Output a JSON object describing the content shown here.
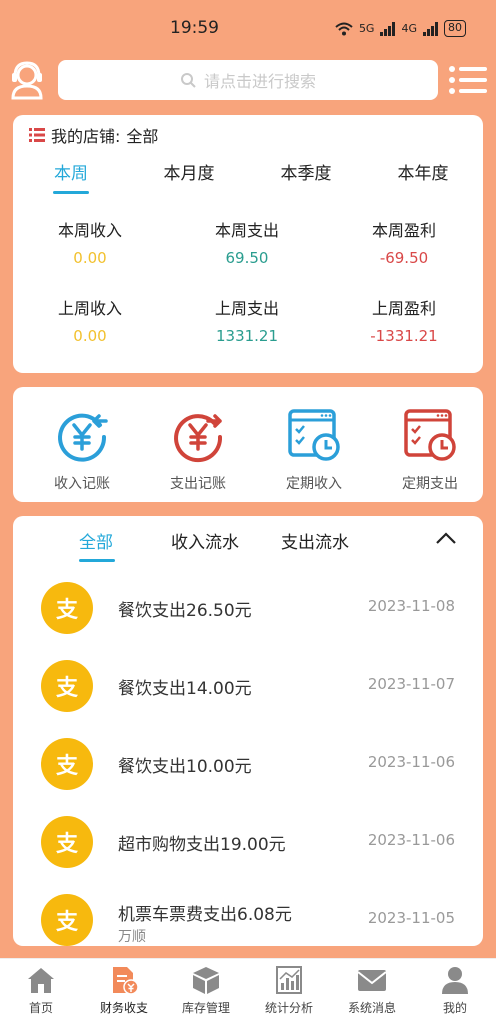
{
  "status_bar": {
    "time": "19:59",
    "net1": "5G",
    "net2": "4G",
    "battery": "80"
  },
  "header": {
    "search_placeholder": "请点击进行搜索",
    "avatar_icon": "user-headset-icon",
    "menu_icon": "list-menu-icon"
  },
  "store": {
    "label": "我的店铺:",
    "value": "全部",
    "tabs": [
      "本周",
      "本月度",
      "本季度",
      "本年度"
    ],
    "active_tab": "本周",
    "stats": [
      {
        "label": "本周收入",
        "value": "0.00",
        "color": "#f2c12e"
      },
      {
        "label": "本周支出",
        "value": "69.50",
        "color": "#2a9d8f"
      },
      {
        "label": "本周盈利",
        "value": "-69.50",
        "color": "#d94848"
      },
      {
        "label": "上周收入",
        "value": "0.00",
        "color": "#f2c12e"
      },
      {
        "label": "上周支出",
        "value": "1331.21",
        "color": "#2a9d8f"
      },
      {
        "label": "上周盈利",
        "value": "-1331.21",
        "color": "#d94848"
      }
    ]
  },
  "actions": [
    {
      "label": "收入记账",
      "icon": "income-yen-icon"
    },
    {
      "label": "支出记账",
      "icon": "expense-yen-icon"
    },
    {
      "label": "定期收入",
      "icon": "scheduled-income-icon"
    },
    {
      "label": "定期支出",
      "icon": "scheduled-expense-icon"
    }
  ],
  "flow": {
    "tabs": [
      "全部",
      "收入流水",
      "支出流水"
    ],
    "active_tab": "全部",
    "coin_glyph": "支",
    "items": [
      {
        "desc": "餐饮支出26.50元",
        "date": "2023-11-08",
        "sub": ""
      },
      {
        "desc": "餐饮支出14.00元",
        "date": "2023-11-07",
        "sub": ""
      },
      {
        "desc": "餐饮支出10.00元",
        "date": "2023-11-06",
        "sub": ""
      },
      {
        "desc": "超市购物支出19.00元",
        "date": "2023-11-06",
        "sub": ""
      },
      {
        "desc": "机票车票费支出6.08元",
        "date": "2023-11-05",
        "sub": "万顺"
      }
    ]
  },
  "bottom_nav": [
    {
      "label": "首页",
      "icon": "home-icon"
    },
    {
      "label": "财务收支",
      "icon": "finance-doc-icon",
      "active": true
    },
    {
      "label": "库存管理",
      "icon": "box-icon"
    },
    {
      "label": "统计分析",
      "icon": "bar-chart-icon"
    },
    {
      "label": "系统消息",
      "icon": "mail-icon"
    },
    {
      "label": "我的",
      "icon": "person-icon"
    }
  ],
  "colors": {
    "background": "#f8a47c",
    "accent": "#23a8d9",
    "coin": "#f7b90e",
    "income_icon": "#2b9fd9",
    "expense_icon": "#d0443a"
  }
}
